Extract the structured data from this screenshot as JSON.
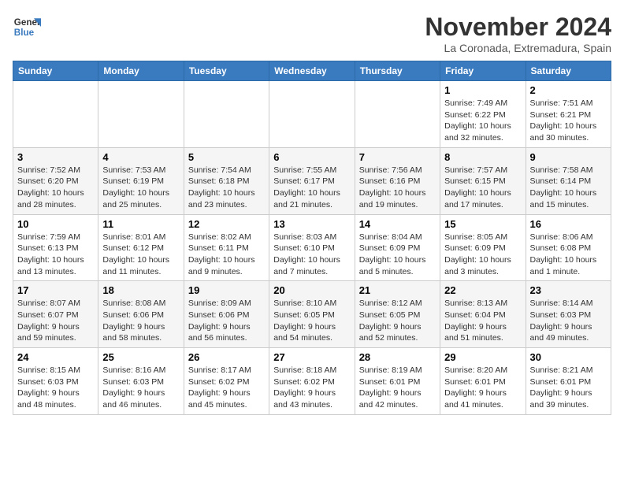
{
  "header": {
    "logo_line1": "General",
    "logo_line2": "Blue",
    "month": "November 2024",
    "location": "La Coronada, Extremadura, Spain"
  },
  "weekdays": [
    "Sunday",
    "Monday",
    "Tuesday",
    "Wednesday",
    "Thursday",
    "Friday",
    "Saturday"
  ],
  "weeks": [
    [
      {
        "day": "",
        "info": ""
      },
      {
        "day": "",
        "info": ""
      },
      {
        "day": "",
        "info": ""
      },
      {
        "day": "",
        "info": ""
      },
      {
        "day": "",
        "info": ""
      },
      {
        "day": "1",
        "info": "Sunrise: 7:49 AM\nSunset: 6:22 PM\nDaylight: 10 hours and 32 minutes."
      },
      {
        "day": "2",
        "info": "Sunrise: 7:51 AM\nSunset: 6:21 PM\nDaylight: 10 hours and 30 minutes."
      }
    ],
    [
      {
        "day": "3",
        "info": "Sunrise: 7:52 AM\nSunset: 6:20 PM\nDaylight: 10 hours and 28 minutes."
      },
      {
        "day": "4",
        "info": "Sunrise: 7:53 AM\nSunset: 6:19 PM\nDaylight: 10 hours and 25 minutes."
      },
      {
        "day": "5",
        "info": "Sunrise: 7:54 AM\nSunset: 6:18 PM\nDaylight: 10 hours and 23 minutes."
      },
      {
        "day": "6",
        "info": "Sunrise: 7:55 AM\nSunset: 6:17 PM\nDaylight: 10 hours and 21 minutes."
      },
      {
        "day": "7",
        "info": "Sunrise: 7:56 AM\nSunset: 6:16 PM\nDaylight: 10 hours and 19 minutes."
      },
      {
        "day": "8",
        "info": "Sunrise: 7:57 AM\nSunset: 6:15 PM\nDaylight: 10 hours and 17 minutes."
      },
      {
        "day": "9",
        "info": "Sunrise: 7:58 AM\nSunset: 6:14 PM\nDaylight: 10 hours and 15 minutes."
      }
    ],
    [
      {
        "day": "10",
        "info": "Sunrise: 7:59 AM\nSunset: 6:13 PM\nDaylight: 10 hours and 13 minutes."
      },
      {
        "day": "11",
        "info": "Sunrise: 8:01 AM\nSunset: 6:12 PM\nDaylight: 10 hours and 11 minutes."
      },
      {
        "day": "12",
        "info": "Sunrise: 8:02 AM\nSunset: 6:11 PM\nDaylight: 10 hours and 9 minutes."
      },
      {
        "day": "13",
        "info": "Sunrise: 8:03 AM\nSunset: 6:10 PM\nDaylight: 10 hours and 7 minutes."
      },
      {
        "day": "14",
        "info": "Sunrise: 8:04 AM\nSunset: 6:09 PM\nDaylight: 10 hours and 5 minutes."
      },
      {
        "day": "15",
        "info": "Sunrise: 8:05 AM\nSunset: 6:09 PM\nDaylight: 10 hours and 3 minutes."
      },
      {
        "day": "16",
        "info": "Sunrise: 8:06 AM\nSunset: 6:08 PM\nDaylight: 10 hours and 1 minute."
      }
    ],
    [
      {
        "day": "17",
        "info": "Sunrise: 8:07 AM\nSunset: 6:07 PM\nDaylight: 9 hours and 59 minutes."
      },
      {
        "day": "18",
        "info": "Sunrise: 8:08 AM\nSunset: 6:06 PM\nDaylight: 9 hours and 58 minutes."
      },
      {
        "day": "19",
        "info": "Sunrise: 8:09 AM\nSunset: 6:06 PM\nDaylight: 9 hours and 56 minutes."
      },
      {
        "day": "20",
        "info": "Sunrise: 8:10 AM\nSunset: 6:05 PM\nDaylight: 9 hours and 54 minutes."
      },
      {
        "day": "21",
        "info": "Sunrise: 8:12 AM\nSunset: 6:05 PM\nDaylight: 9 hours and 52 minutes."
      },
      {
        "day": "22",
        "info": "Sunrise: 8:13 AM\nSunset: 6:04 PM\nDaylight: 9 hours and 51 minutes."
      },
      {
        "day": "23",
        "info": "Sunrise: 8:14 AM\nSunset: 6:03 PM\nDaylight: 9 hours and 49 minutes."
      }
    ],
    [
      {
        "day": "24",
        "info": "Sunrise: 8:15 AM\nSunset: 6:03 PM\nDaylight: 9 hours and 48 minutes."
      },
      {
        "day": "25",
        "info": "Sunrise: 8:16 AM\nSunset: 6:03 PM\nDaylight: 9 hours and 46 minutes."
      },
      {
        "day": "26",
        "info": "Sunrise: 8:17 AM\nSunset: 6:02 PM\nDaylight: 9 hours and 45 minutes."
      },
      {
        "day": "27",
        "info": "Sunrise: 8:18 AM\nSunset: 6:02 PM\nDaylight: 9 hours and 43 minutes."
      },
      {
        "day": "28",
        "info": "Sunrise: 8:19 AM\nSunset: 6:01 PM\nDaylight: 9 hours and 42 minutes."
      },
      {
        "day": "29",
        "info": "Sunrise: 8:20 AM\nSunset: 6:01 PM\nDaylight: 9 hours and 41 minutes."
      },
      {
        "day": "30",
        "info": "Sunrise: 8:21 AM\nSunset: 6:01 PM\nDaylight: 9 hours and 39 minutes."
      }
    ]
  ]
}
